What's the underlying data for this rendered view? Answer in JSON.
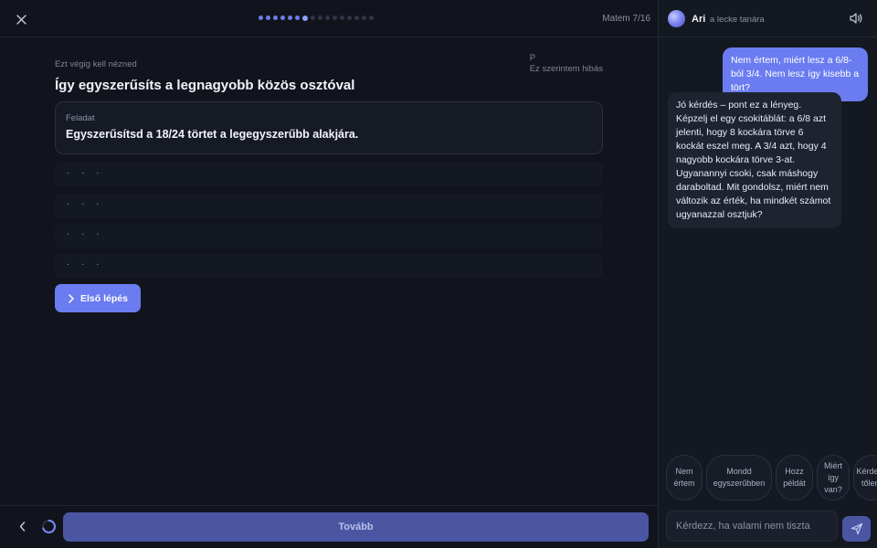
{
  "header": {
    "progress": {
      "total": 16,
      "current": 7
    },
    "step_counter": "Matem 7/16"
  },
  "lesson": {
    "eyebrow": "Ezt végig kell nézned",
    "report": {
      "key": "P",
      "label": "Ez szerintem hibás"
    },
    "title": "Így egyszerűsíts a legnagyobb közös osztóval",
    "task": {
      "label": "Feladat",
      "text": "Egyszerűsítsd a 18/24 törtet a legegyszerűbb alakjára."
    },
    "steps": [
      "· · ·",
      "· · ·",
      "· · ·",
      "· · ·"
    ],
    "first_step_label": "Első lépés"
  },
  "footer": {
    "next_label": "Tovább"
  },
  "chat": {
    "tutor_name": "Ari",
    "tutor_role": "a lecke tanára",
    "messages": [
      {
        "role": "user",
        "text": "Nem értem, miért lesz a 6/8-ból 3/4. Nem lesz így kisebb a tört?"
      },
      {
        "role": "tutor",
        "text": "Jó kérdés – pont ez a lényeg. Képzelj el egy csokitáblát: a 6/8 azt jelenti, hogy 8 kockára törve 6 kockát eszel meg. A 3/4 azt, hogy 4 nagyobb kockára törve 3-at. Ugyanannyi csoki, csak máshogy daraboltad. Mit gondolsz, miért nem változik az érték, ha mindkét számot ugyanazzal osztjuk?"
      }
    ],
    "chips": [
      "Nem értem",
      "Mondd egyszerűbben",
      "Hozz példát",
      "Miért így van?",
      "Kérdezz tőlem"
    ],
    "input_placeholder": "Kérdezz, ha valami nem tiszta"
  },
  "colors": {
    "accent": "#6a7cf0",
    "accent_muted": "#4b56a3",
    "background": "#11141c"
  },
  "icons": [
    "close-icon",
    "chevron-left-icon",
    "chevron-right-icon",
    "speaker-icon",
    "send-icon",
    "loading-spinner-icon"
  ]
}
